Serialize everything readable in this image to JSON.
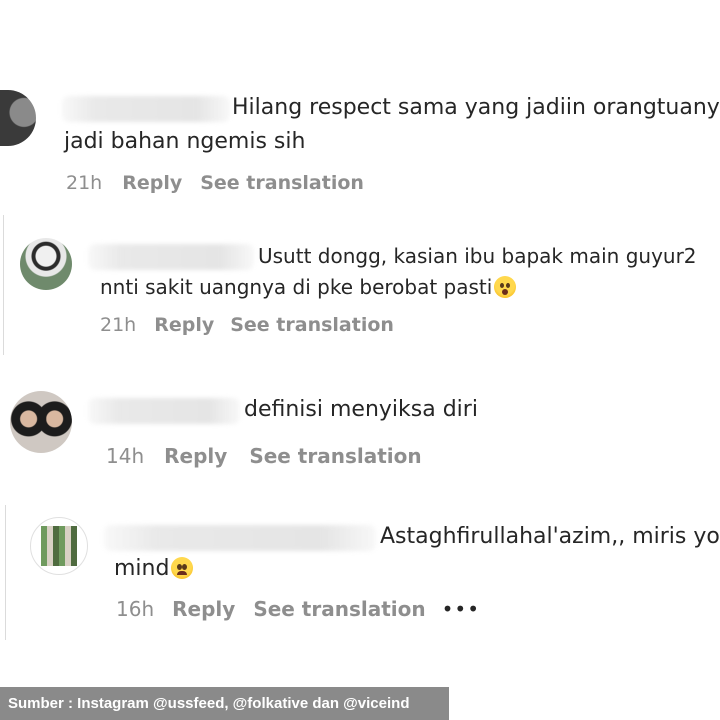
{
  "comments": [
    {
      "text_line1": "Hilang respect sama yang jadiin orangtuanya",
      "text_line2": "jadi bahan ngemis sih",
      "time": "21h",
      "reply": "Reply",
      "translation": "See translation"
    },
    {
      "text_line1": "Usutt dongg, kasian ibu bapak main guyur2",
      "text_line2": "nnti sakit uangnya di pke berobat pasti",
      "emoji": "astonished-face-emoji",
      "time": "21h",
      "reply": "Reply",
      "translation": "See translation"
    },
    {
      "text_line1": "definisi menyiksa diri",
      "time": "14h",
      "reply": "Reply",
      "translation": "See translation"
    },
    {
      "text_line1": "Astaghfirullahal'azim,, miris your",
      "text_line2": "mind",
      "emoji": "pleading-face-emoji",
      "time": "16h",
      "reply": "Reply",
      "translation": "See translation",
      "more": "•••"
    }
  ],
  "source": "Sumber : Instagram @ussfeed, @folkative dan @viceind",
  "colors": {
    "text": "#262626",
    "meta": "#8e8e8e",
    "source_bar": "#8a8a8a"
  }
}
